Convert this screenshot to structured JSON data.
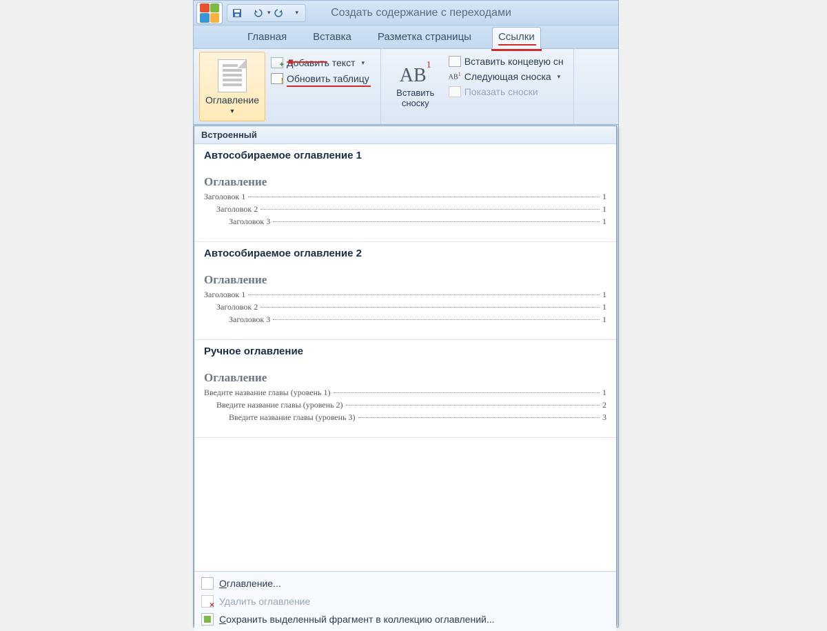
{
  "titlebar": {
    "title": "Создать содержание с переходами"
  },
  "qat": {
    "save": "save-icon",
    "undo": "undo-icon",
    "redo": "redo-icon"
  },
  "tabs": {
    "home": "Главная",
    "insert": "Вставка",
    "page_layout": "Разметка страницы",
    "references": "Ссылки"
  },
  "ribbon": {
    "toc_button": "Оглавление",
    "add_text": "Добавить текст",
    "update_table": "Обновить таблицу",
    "insert_footnote": "Вставить сноску",
    "insert_endnote": "Вставить концевую сн",
    "next_footnote": "Следующая сноска",
    "show_notes": "Показать сноски"
  },
  "gallery": {
    "section_header": "Встроенный",
    "items": [
      {
        "title": "Автособираемое оглавление 1",
        "toc_heading": "Оглавление",
        "lines": [
          {
            "level": 1,
            "text": "Заголовок 1",
            "page": "1"
          },
          {
            "level": 2,
            "text": "Заголовок 2",
            "page": "1"
          },
          {
            "level": 3,
            "text": "Заголовок 3",
            "page": "1"
          }
        ]
      },
      {
        "title": "Автособираемое оглавление 2",
        "toc_heading": "Оглавление",
        "lines": [
          {
            "level": 1,
            "text": "Заголовок 1",
            "page": "1"
          },
          {
            "level": 2,
            "text": "Заголовок 2",
            "page": "1"
          },
          {
            "level": 3,
            "text": "Заголовок 3",
            "page": "1"
          }
        ]
      },
      {
        "title": "Ручное оглавление",
        "toc_heading": "Оглавление",
        "lines": [
          {
            "level": 1,
            "text": "Введите название главы (уровень 1)",
            "page": "1"
          },
          {
            "level": 2,
            "text": "Введите название главы (уровень 2)",
            "page": "2"
          },
          {
            "level": 3,
            "text": "Введите название главы (уровень 3)",
            "page": "3"
          }
        ]
      }
    ],
    "footer": {
      "custom_toc": "Оглавление...",
      "remove_toc": "Удалить оглавление",
      "save_selection": "Сохранить выделенный фрагмент в коллекцию оглавлений..."
    }
  }
}
